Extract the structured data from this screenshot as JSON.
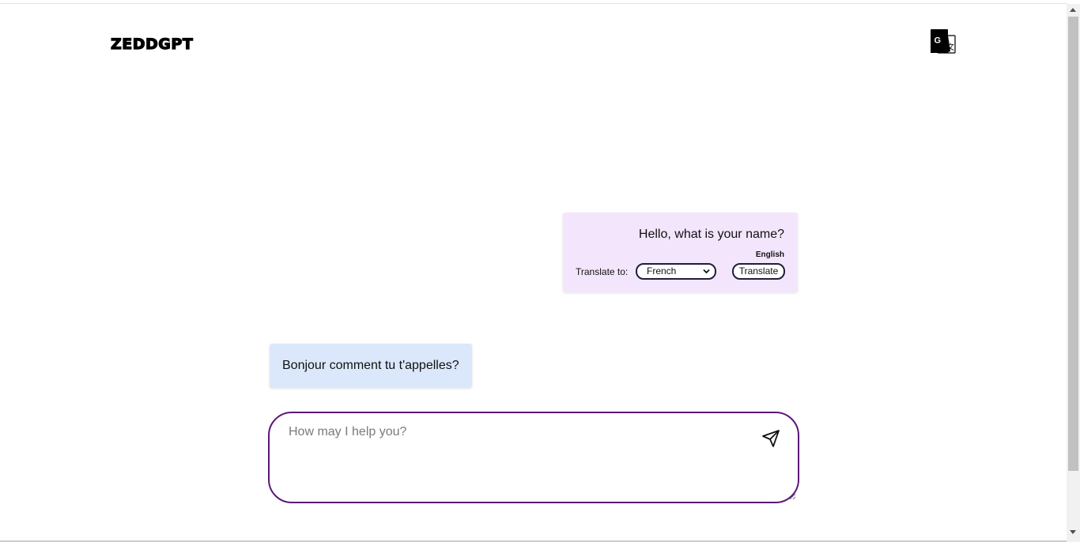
{
  "header": {
    "logo_text": "ZEDDGPT",
    "translate_icon": "google-translate-icon"
  },
  "chat": {
    "user_message": {
      "text": "Hello, what is your name?",
      "language": "English",
      "translate_to_label": "Translate to:",
      "selected_language": "French",
      "translate_button_label": "Translate"
    },
    "bot_message": {
      "text": "Bonjour comment tu t'appelles?"
    }
  },
  "prompt": {
    "placeholder": "How may I help you?",
    "value": "",
    "send_icon": "send-paper-plane-icon"
  },
  "colors": {
    "user_bubble_bg": "#f3e6fc",
    "bot_bubble_bg": "#dbe8fb",
    "prompt_border": "#5b1878"
  }
}
